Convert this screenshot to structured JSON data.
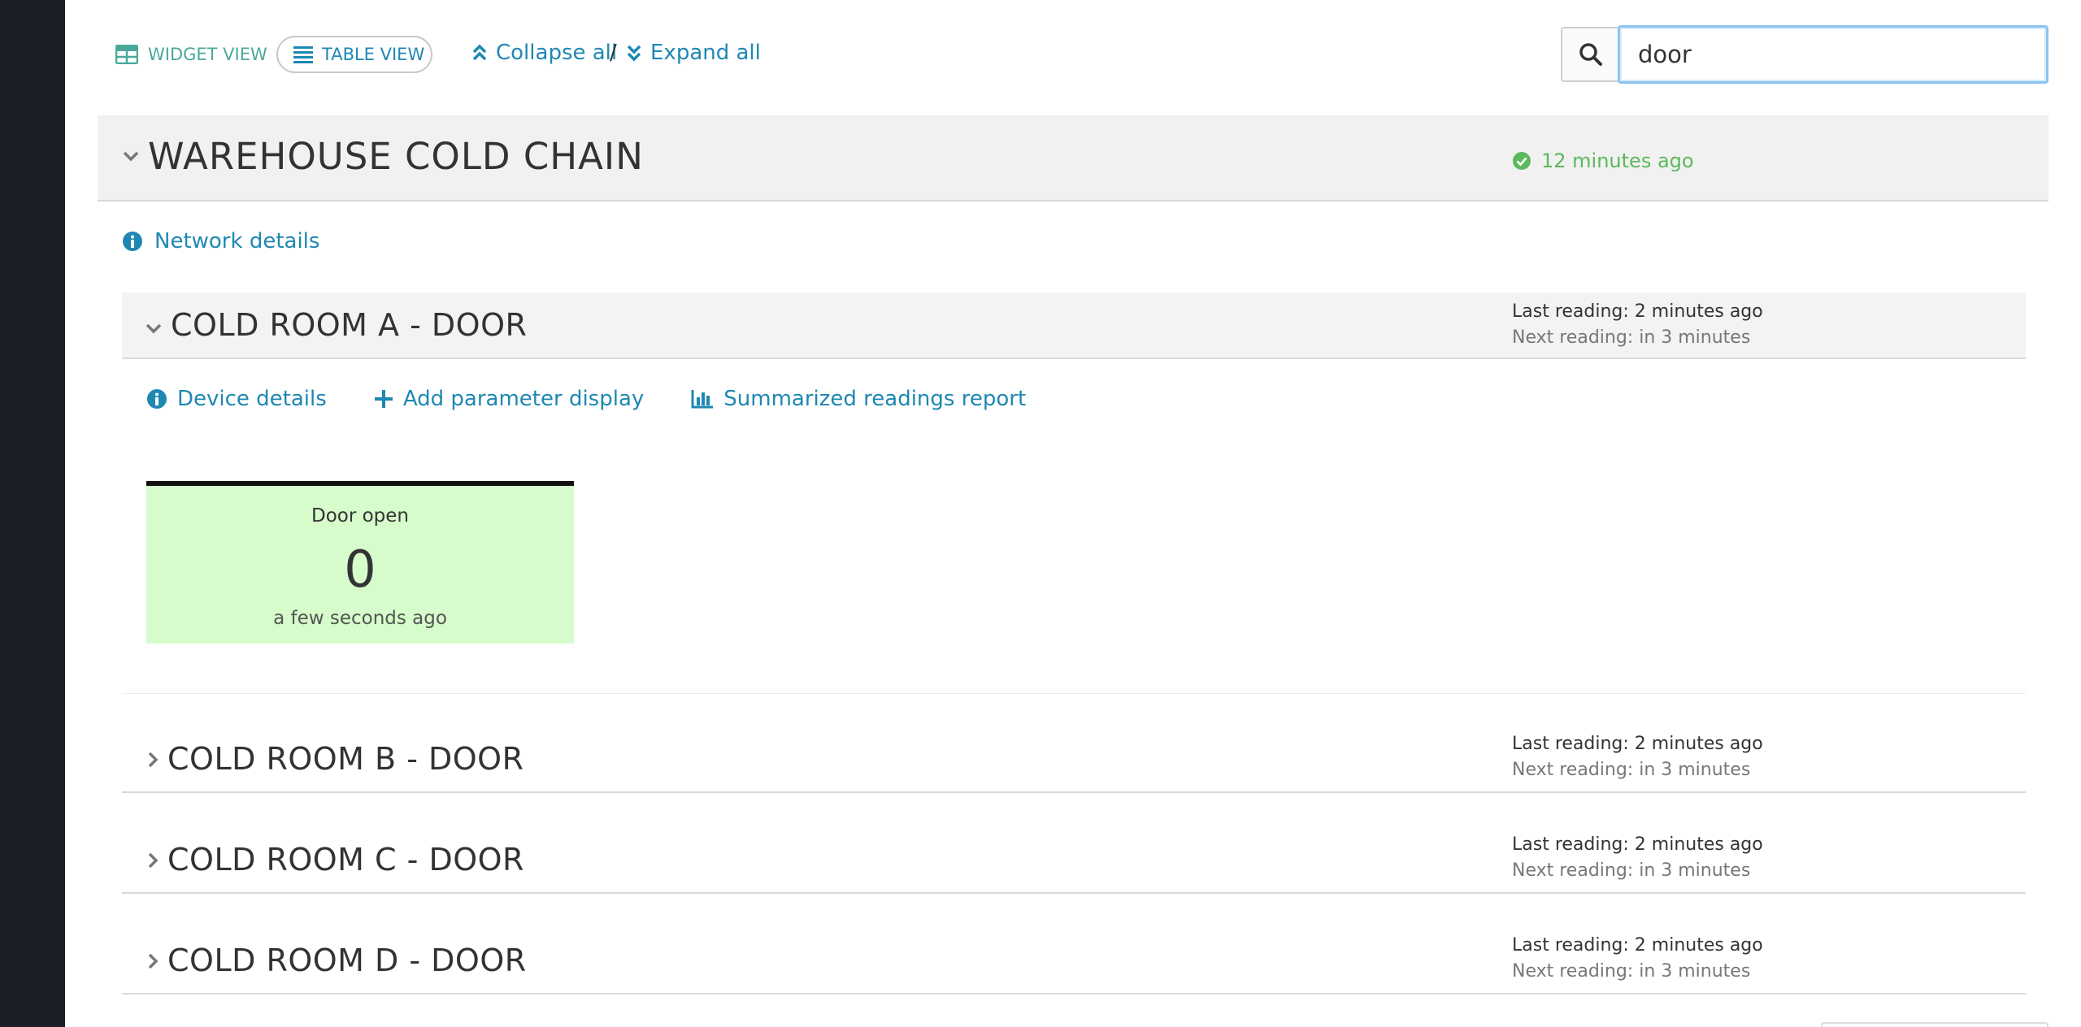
{
  "toolbar": {
    "widget_view_label": "WIDGET VIEW",
    "table_view_label": "TABLE VIEW",
    "collapse_all_label": "Collapse all",
    "separator": "/",
    "expand_all_label": "Expand all"
  },
  "search": {
    "value": "door"
  },
  "network": {
    "title": "WAREHOUSE COLD CHAIN",
    "status_text": "12 minutes ago",
    "status_color": "#5cb85c",
    "details_link": "Network details"
  },
  "devices": [
    {
      "title": "COLD ROOM A - DOOR",
      "expanded": true,
      "last_reading": "Last reading: 2 minutes ago",
      "next_reading": "Next reading: in 3 minutes",
      "actions": [
        "Device details",
        "Add parameter display",
        "Summarized readings report"
      ],
      "widget": {
        "label": "Door open",
        "value": "0",
        "time": "a few seconds ago",
        "background": "#d5fcca"
      }
    },
    {
      "title": "COLD ROOM B - DOOR",
      "expanded": false,
      "last_reading": "Last reading: 2 minutes ago",
      "next_reading": "Next reading: in 3 minutes"
    },
    {
      "title": "COLD ROOM C - DOOR",
      "expanded": false,
      "last_reading": "Last reading: 2 minutes ago",
      "next_reading": "Next reading: in 3 minutes"
    },
    {
      "title": "COLD ROOM D - DOOR",
      "expanded": false,
      "last_reading": "Last reading: 2 minutes ago",
      "next_reading": "Next reading: in 3 minutes"
    }
  ],
  "icons": {
    "widget_view": "widget-grid-icon",
    "table_view": "list-icon",
    "collapse_all": "double-chevron-up-icon",
    "expand_all": "double-chevron-down-icon",
    "search": "search-icon",
    "status": "check-circle-icon",
    "info": "info-circle-icon",
    "add": "plus-icon",
    "report": "bar-chart-icon",
    "collapse": "chevron-down-icon",
    "expand": "chevron-right-icon"
  },
  "colors": {
    "link": "#1e88b3",
    "widget_view_accent": "#4aa89a",
    "sidebar": "#1b1f27"
  }
}
